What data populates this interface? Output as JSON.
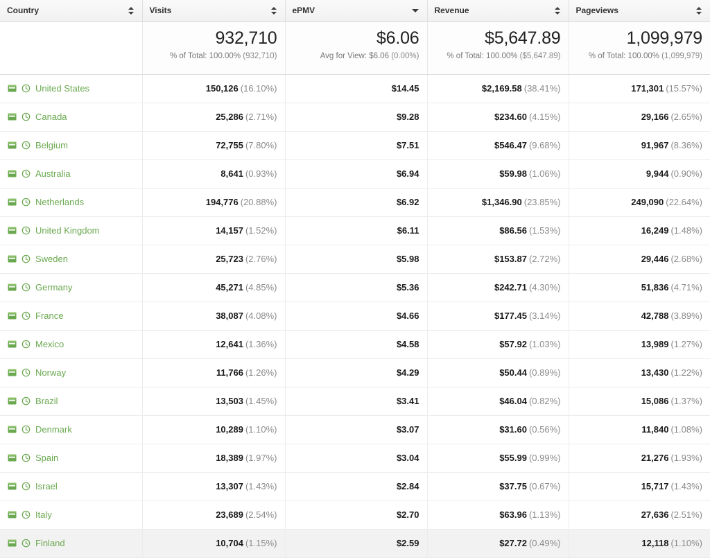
{
  "theme": {
    "link_green": "#6aa84f",
    "header_bg": "#f4f4f4",
    "text_dark": "#222222",
    "text_muted": "#8a8a8a",
    "hover_row_bg": "#f2f2f2"
  },
  "table": {
    "columns": [
      {
        "key": "country",
        "label": "Country",
        "align": "left",
        "sort": "none"
      },
      {
        "key": "visits",
        "label": "Visits",
        "align": "right",
        "sort": "none"
      },
      {
        "key": "epmv",
        "label": "ePMV",
        "align": "right",
        "sort": "desc"
      },
      {
        "key": "revenue",
        "label": "Revenue",
        "align": "right",
        "sort": "none"
      },
      {
        "key": "pageviews",
        "label": "Pageviews",
        "align": "right",
        "sort": "none"
      }
    ],
    "summary": {
      "country": {
        "big": "",
        "sub": ""
      },
      "visits": {
        "big": "932,710",
        "sub_prefix": "% of Total: 100.00%",
        "sub_paren": "(932,710)"
      },
      "epmv": {
        "big": "$6.06",
        "sub_prefix": "Avg for View: $6.06",
        "sub_paren": "(0.00%)"
      },
      "revenue": {
        "big": "$5,647.89",
        "sub_prefix": "% of Total: 100.00%",
        "sub_paren": "($5,647.89)"
      },
      "pageviews": {
        "big": "1,099,979",
        "sub_prefix": "% of Total: 100.00%",
        "sub_paren": "(1,099,979)"
      }
    },
    "row_icons": [
      "segment-icon",
      "clock-icon"
    ],
    "rows": [
      {
        "country": "United States",
        "visits": "150,126",
        "visits_pct": "(16.10%)",
        "epmv": "$14.45",
        "revenue": "$2,169.58",
        "revenue_pct": "(38.41%)",
        "pageviews": "171,301",
        "pageviews_pct": "(15.57%)",
        "hover": false
      },
      {
        "country": "Canada",
        "visits": "25,286",
        "visits_pct": "(2.71%)",
        "epmv": "$9.28",
        "revenue": "$234.60",
        "revenue_pct": "(4.15%)",
        "pageviews": "29,166",
        "pageviews_pct": "(2.65%)",
        "hover": false
      },
      {
        "country": "Belgium",
        "visits": "72,755",
        "visits_pct": "(7.80%)",
        "epmv": "$7.51",
        "revenue": "$546.47",
        "revenue_pct": "(9.68%)",
        "pageviews": "91,967",
        "pageviews_pct": "(8.36%)",
        "hover": false
      },
      {
        "country": "Australia",
        "visits": "8,641",
        "visits_pct": "(0.93%)",
        "epmv": "$6.94",
        "revenue": "$59.98",
        "revenue_pct": "(1.06%)",
        "pageviews": "9,944",
        "pageviews_pct": "(0.90%)",
        "hover": false
      },
      {
        "country": "Netherlands",
        "visits": "194,776",
        "visits_pct": "(20.88%)",
        "epmv": "$6.92",
        "revenue": "$1,346.90",
        "revenue_pct": "(23.85%)",
        "pageviews": "249,090",
        "pageviews_pct": "(22.64%)",
        "hover": false
      },
      {
        "country": "United Kingdom",
        "visits": "14,157",
        "visits_pct": "(1.52%)",
        "epmv": "$6.11",
        "revenue": "$86.56",
        "revenue_pct": "(1.53%)",
        "pageviews": "16,249",
        "pageviews_pct": "(1.48%)",
        "hover": false
      },
      {
        "country": "Sweden",
        "visits": "25,723",
        "visits_pct": "(2.76%)",
        "epmv": "$5.98",
        "revenue": "$153.87",
        "revenue_pct": "(2.72%)",
        "pageviews": "29,446",
        "pageviews_pct": "(2.68%)",
        "hover": false
      },
      {
        "country": "Germany",
        "visits": "45,271",
        "visits_pct": "(4.85%)",
        "epmv": "$5.36",
        "revenue": "$242.71",
        "revenue_pct": "(4.30%)",
        "pageviews": "51,836",
        "pageviews_pct": "(4.71%)",
        "hover": false
      },
      {
        "country": "France",
        "visits": "38,087",
        "visits_pct": "(4.08%)",
        "epmv": "$4.66",
        "revenue": "$177.45",
        "revenue_pct": "(3.14%)",
        "pageviews": "42,788",
        "pageviews_pct": "(3.89%)",
        "hover": false
      },
      {
        "country": "Mexico",
        "visits": "12,641",
        "visits_pct": "(1.36%)",
        "epmv": "$4.58",
        "revenue": "$57.92",
        "revenue_pct": "(1.03%)",
        "pageviews": "13,989",
        "pageviews_pct": "(1.27%)",
        "hover": false
      },
      {
        "country": "Norway",
        "visits": "11,766",
        "visits_pct": "(1.26%)",
        "epmv": "$4.29",
        "revenue": "$50.44",
        "revenue_pct": "(0.89%)",
        "pageviews": "13,430",
        "pageviews_pct": "(1.22%)",
        "hover": false
      },
      {
        "country": "Brazil",
        "visits": "13,503",
        "visits_pct": "(1.45%)",
        "epmv": "$3.41",
        "revenue": "$46.04",
        "revenue_pct": "(0.82%)",
        "pageviews": "15,086",
        "pageviews_pct": "(1.37%)",
        "hover": false
      },
      {
        "country": "Denmark",
        "visits": "10,289",
        "visits_pct": "(1.10%)",
        "epmv": "$3.07",
        "revenue": "$31.60",
        "revenue_pct": "(0.56%)",
        "pageviews": "11,840",
        "pageviews_pct": "(1.08%)",
        "hover": false
      },
      {
        "country": "Spain",
        "visits": "18,389",
        "visits_pct": "(1.97%)",
        "epmv": "$3.04",
        "revenue": "$55.99",
        "revenue_pct": "(0.99%)",
        "pageviews": "21,276",
        "pageviews_pct": "(1.93%)",
        "hover": false
      },
      {
        "country": "Israel",
        "visits": "13,307",
        "visits_pct": "(1.43%)",
        "epmv": "$2.84",
        "revenue": "$37.75",
        "revenue_pct": "(0.67%)",
        "pageviews": "15,717",
        "pageviews_pct": "(1.43%)",
        "hover": false
      },
      {
        "country": "Italy",
        "visits": "23,689",
        "visits_pct": "(2.54%)",
        "epmv": "$2.70",
        "revenue": "$63.96",
        "revenue_pct": "(1.13%)",
        "pageviews": "27,636",
        "pageviews_pct": "(2.51%)",
        "hover": false
      },
      {
        "country": "Finland",
        "visits": "10,704",
        "visits_pct": "(1.15%)",
        "epmv": "$2.59",
        "revenue": "$27.72",
        "revenue_pct": "(0.49%)",
        "pageviews": "12,118",
        "pageviews_pct": "(1.10%)",
        "hover": true
      }
    ]
  }
}
